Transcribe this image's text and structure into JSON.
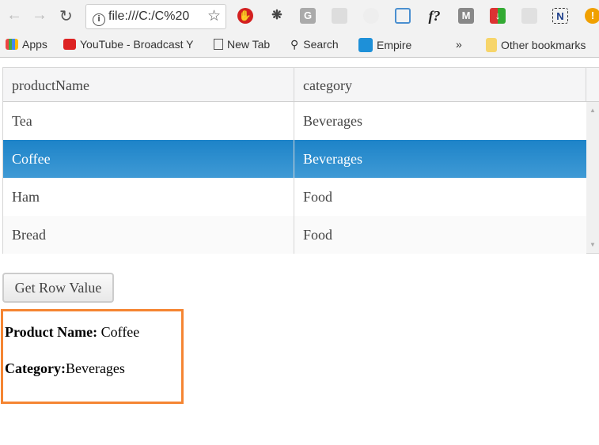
{
  "browser": {
    "address": "file:///C:/C%20",
    "extensions": [
      "adblock-icon",
      "bug-icon",
      "grammarly-icon",
      "shield-icon",
      "alert-icon",
      "screen-capture-icon",
      "font-finder-icon",
      "mcafee-icon",
      "download-icon",
      "pocket-icon",
      "newsletter-icon",
      "warning-icon"
    ],
    "bookmarks": [
      {
        "label": "Apps",
        "icon": "apps-grid-icon"
      },
      {
        "label": "YouTube - Broadcast Y",
        "icon": "youtube-icon"
      },
      {
        "label": "New Tab",
        "icon": "page-icon"
      },
      {
        "label": "Search",
        "icon": "search-icon"
      },
      {
        "label": "Empire",
        "icon": "empire-icon"
      }
    ],
    "overflow": "»",
    "other_bookmarks": "Other bookmarks"
  },
  "grid": {
    "columns": [
      "productName",
      "category"
    ],
    "rows": [
      [
        "Tea",
        "Beverages"
      ],
      [
        "Coffee",
        "Beverages"
      ],
      [
        "Ham",
        "Food"
      ],
      [
        "Bread",
        "Food"
      ]
    ],
    "selected_row": 1,
    "selection_color": "#1d83c8"
  },
  "button": {
    "label": "Get Row Value"
  },
  "result": {
    "name_label": "Product Name:",
    "name_value": " Coffee",
    "category_label": "Category:",
    "category_value": "Beverages",
    "border_color": "#f58532"
  }
}
